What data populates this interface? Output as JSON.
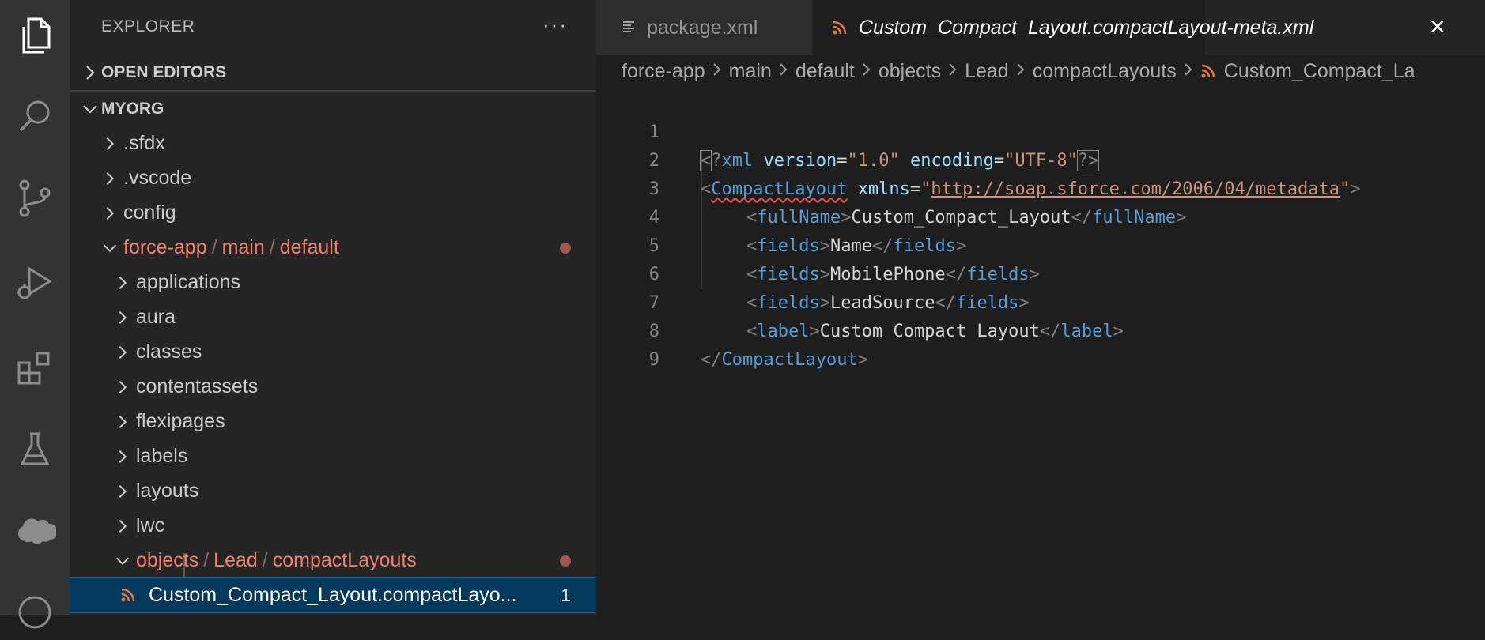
{
  "sidebar": {
    "title": "EXPLORER",
    "more": "···",
    "open_editors": "OPEN EDITORS",
    "workspace": "MYORG",
    "tree": [
      {
        "label": ".sfdx"
      },
      {
        "label": ".vscode"
      },
      {
        "label": "config"
      },
      {
        "label_parts": [
          "force-app",
          "main",
          "default"
        ]
      },
      {
        "label": "applications"
      },
      {
        "label": "aura"
      },
      {
        "label": "classes"
      },
      {
        "label": "contentassets"
      },
      {
        "label": "flexipages"
      },
      {
        "label": "labels"
      },
      {
        "label": "layouts"
      },
      {
        "label": "lwc"
      },
      {
        "label_parts": [
          "objects",
          "Lead",
          "compactLayouts"
        ]
      },
      {
        "label": "Custom_Compact_Layout.compactLayo...",
        "badge": "1"
      }
    ]
  },
  "tabs": [
    {
      "label": "package.xml",
      "icon": "lines-icon"
    },
    {
      "label": "Custom_Compact_Layout.compactLayout-meta.xml",
      "icon": "rss-icon",
      "close": "×"
    }
  ],
  "breadcrumb": [
    "force-app",
    "main",
    "default",
    "objects",
    "Lead",
    "compactLayouts",
    "Custom_Compact_La"
  ],
  "code": {
    "line_numbers": [
      "1",
      "2",
      "3",
      "4",
      "5",
      "6",
      "7",
      "8",
      "9"
    ],
    "xml_decl": {
      "lt": "<",
      "q": "?",
      "name": "xml",
      "a1": "version",
      "v1": "\"1.0\"",
      "a2": "encoding",
      "v2": "\"UTF-8\"",
      "end": "?>"
    },
    "root": {
      "tag": "CompactLayout",
      "attr": "xmlns",
      "eq": "=",
      "q": "\"",
      "url": "http://soap.sforce.com/2006/04/metadata"
    },
    "fullName": {
      "tag": "fullName",
      "value": "Custom_Compact_Layout"
    },
    "fields": [
      {
        "tag": "fields",
        "value": "Name"
      },
      {
        "tag": "fields",
        "value": "MobilePhone"
      },
      {
        "tag": "fields",
        "value": "LeadSource"
      }
    ],
    "label": {
      "tag": "label",
      "value": "Custom Compact Layout"
    },
    "close_root": "CompactLayout"
  },
  "colors": {
    "accent": "#0e639c",
    "modified": "#f0806b",
    "tag": "#569cd6",
    "string": "#ce9178"
  }
}
